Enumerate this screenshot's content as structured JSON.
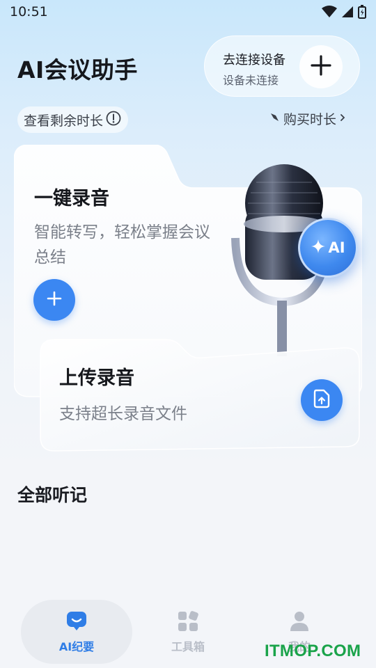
{
  "status_bar": {
    "time": "10:51"
  },
  "header": {
    "title": "AI会议助手",
    "device": {
      "title": "去连接设备",
      "status": "设备未连接"
    }
  },
  "quota": {
    "remain_label": "查看剩余时长",
    "buy_label": "购买时长"
  },
  "record_card": {
    "title": "一键录音",
    "description": "智能转写，轻松掌握会议总结",
    "ai_badge": "AI"
  },
  "upload_card": {
    "title": "上传录音",
    "description": "支持超长录音文件"
  },
  "section": {
    "title": "全部听记"
  },
  "bottom_nav": {
    "items": [
      {
        "label": "AI纪要",
        "icon": "ai-summary-icon",
        "active": true
      },
      {
        "label": "工具箱",
        "icon": "toolbox-icon",
        "active": false
      },
      {
        "label": "我的",
        "icon": "profile-icon",
        "active": false
      }
    ]
  },
  "watermark": "ITMOP.COM",
  "colors": {
    "accent": "#3b87f2",
    "active_nav": "#2f7de6",
    "inactive_nav": "#b9bec8",
    "watermark": "#1aa34a"
  }
}
